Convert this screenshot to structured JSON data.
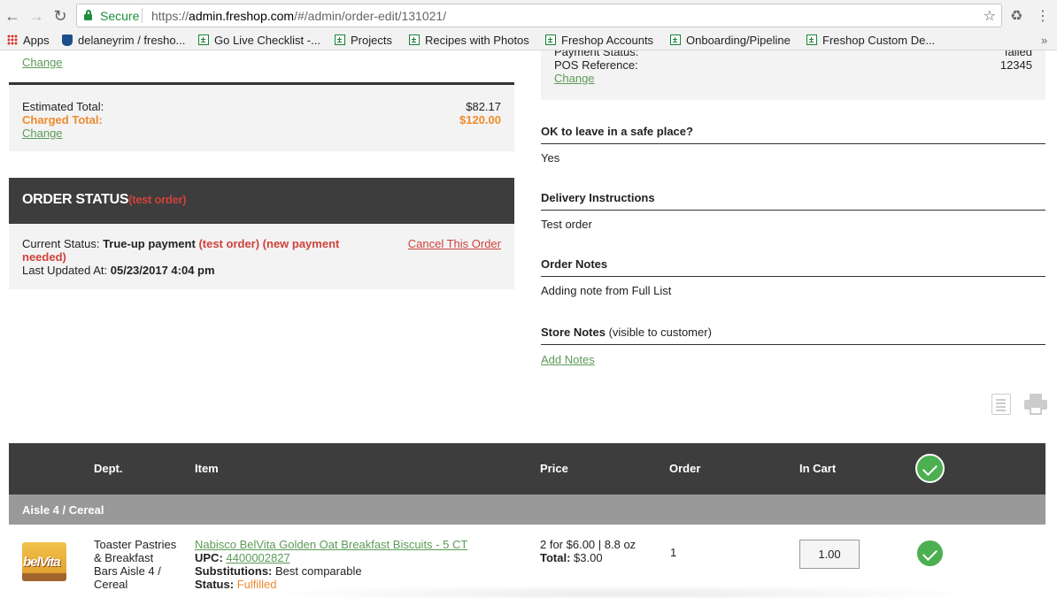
{
  "browser": {
    "secure_label": "Secure",
    "url_scheme": "https://",
    "url_host": "admin.freshop.com",
    "url_path": "/#/admin/order-edit/131021/"
  },
  "bookmarks": [
    {
      "label": "Apps",
      "icon": "apps-grid-icon"
    },
    {
      "label": "delaneyrim / fresho...",
      "icon": "github-icon"
    },
    {
      "label": "Go Live Checklist -...",
      "icon": "sheets-icon"
    },
    {
      "label": "Projects",
      "icon": "sheets-icon"
    },
    {
      "label": "Recipes with Photos",
      "icon": "sheets-icon"
    },
    {
      "label": "Freshop Accounts",
      "icon": "sheets-icon"
    },
    {
      "label": "Onboarding/Pipeline",
      "icon": "sheets-icon"
    },
    {
      "label": "Freshop Custom De...",
      "icon": "sheets-icon"
    }
  ],
  "bookmarks_more": "»",
  "summary": {
    "change_top": "Change",
    "estimated_total_label": "Estimated Total:",
    "estimated_total_value": "$82.17",
    "charged_total_label": "Charged Total:",
    "charged_total_value": "$120.00",
    "change_label": "Change"
  },
  "payment": {
    "payment_status_label": "Payment Status:",
    "payment_status_value": "failed",
    "pos_reference_label": "POS Reference:",
    "pos_reference_value": "12345",
    "change_label": "Change"
  },
  "order_status": {
    "title": "ORDER STATUS",
    "title_tag": "(test order)",
    "current_status_label": "Current Status:",
    "current_status_value": "True-up payment",
    "current_status_tags": "(test order) (new payment needed)",
    "last_updated_label": "Last Updated At:",
    "last_updated_value": "05/23/2017 4:04 pm",
    "cancel_label": "Cancel This Order"
  },
  "details": {
    "safe_place_title": "OK to leave in a safe place?",
    "safe_place_value": "Yes",
    "delivery_title": "Delivery Instructions",
    "delivery_value": "Test order",
    "order_notes_title": "Order Notes",
    "order_notes_value": "Adding note from Full List",
    "store_notes_title": "Store Notes",
    "store_notes_sub": "(visible to customer)",
    "add_notes_label": "Add Notes"
  },
  "table": {
    "headers": {
      "dept": "Dept.",
      "item": "Item",
      "price": "Price",
      "order": "Order",
      "in_cart": "In Cart"
    },
    "group": "Aisle 4 / Cereal",
    "rows": [
      {
        "image_text": "belVita",
        "dept": "Toaster Pastries & Breakfast Bars Aisle 4 / Cereal",
        "item_name": "Nabisco BelVita Golden Oat Breakfast Biscuits - 5 CT",
        "upc_label": "UPC:",
        "upc_value": "4400002827",
        "subs_label": "Substitutions:",
        "subs_value": "Best comparable",
        "status_label": "Status:",
        "status_value": "Fulfilled",
        "price": "2 for $6.00 | 8.8 oz",
        "total_label": "Total:",
        "total_value": "$3.00",
        "order_qty": "1",
        "in_cart_qty": "1.00"
      }
    ]
  },
  "colors": {
    "link": "#5c9b57",
    "accent_orange": "#ef8b2c",
    "accent_red": "#d0423b",
    "header_dark": "#3d3d3d",
    "check_green": "#4caf50"
  }
}
